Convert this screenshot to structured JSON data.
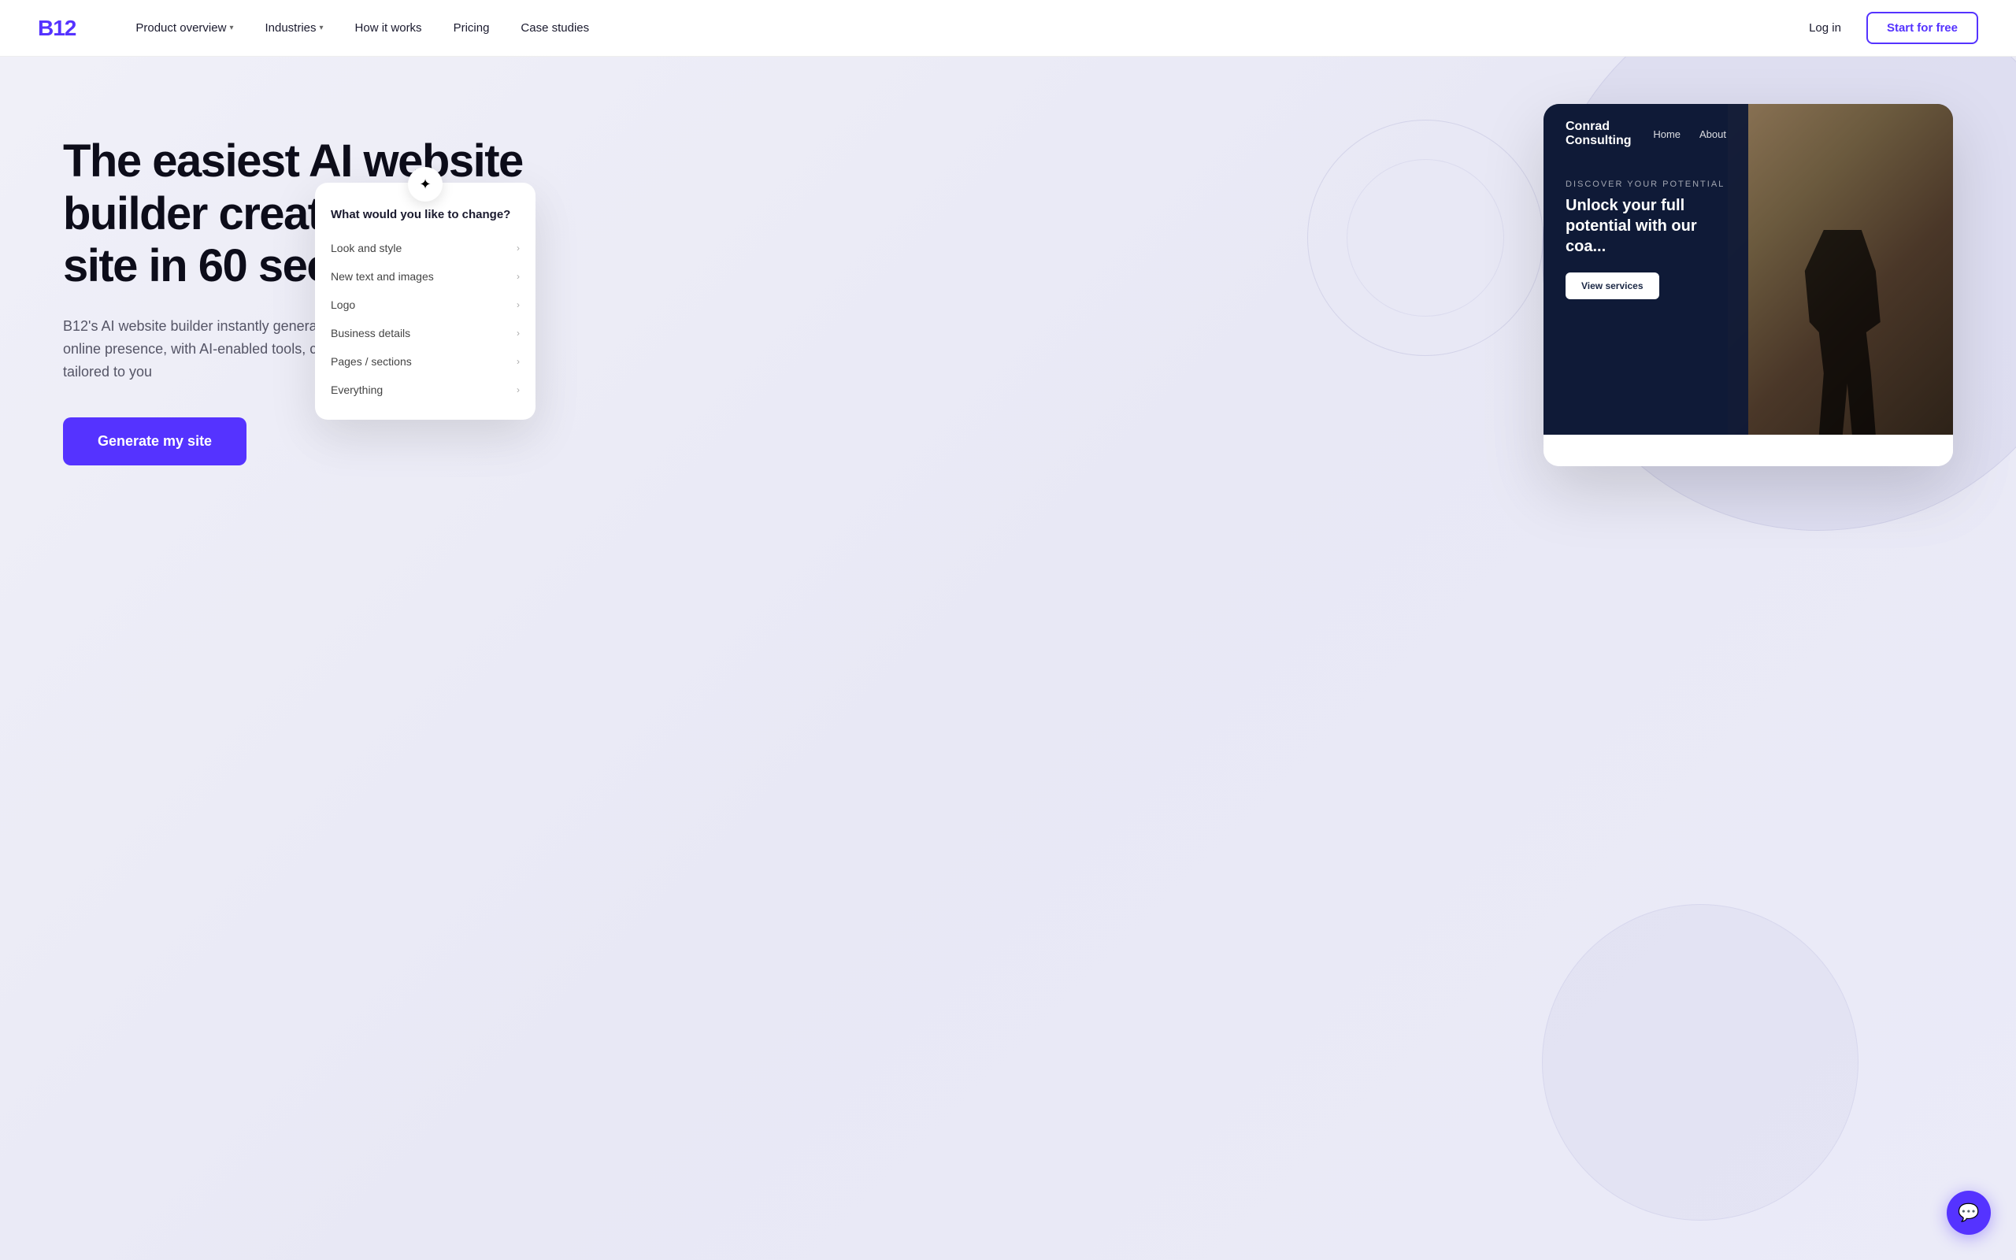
{
  "brand": {
    "logo": "B12",
    "color": "#5533FF"
  },
  "nav": {
    "links": [
      {
        "label": "Product overview",
        "hasDropdown": true
      },
      {
        "label": "Industries",
        "hasDropdown": true
      },
      {
        "label": "How it works",
        "hasDropdown": false
      },
      {
        "label": "Pricing",
        "hasDropdown": false
      },
      {
        "label": "Case studies",
        "hasDropdown": false
      }
    ],
    "login_label": "Log in",
    "start_label": "Start for free"
  },
  "hero": {
    "title": "The easiest AI website builder creates your site in 60 seconds",
    "subtitle": "B12's AI website builder instantly generates your professional online presence, with AI-enabled tools, content, and images tailored to you",
    "cta_label": "Generate my site"
  },
  "site_preview": {
    "company_name": "Conrad Consulting",
    "nav_links": [
      "Home",
      "About"
    ],
    "eyebrow": "DISCOVER YOUR POTENTIAL",
    "headline": "Unlock your full potential with our coa...",
    "cta": "View services"
  },
  "ai_popup": {
    "sparkle": "✦",
    "title": "What would you like to change?",
    "items": [
      {
        "label": "Look and style"
      },
      {
        "label": "New text and images"
      },
      {
        "label": "Logo"
      },
      {
        "label": "Business details"
      },
      {
        "label": "Pages / sections"
      },
      {
        "label": "Everything"
      }
    ]
  },
  "chat": {
    "icon": "💬"
  }
}
